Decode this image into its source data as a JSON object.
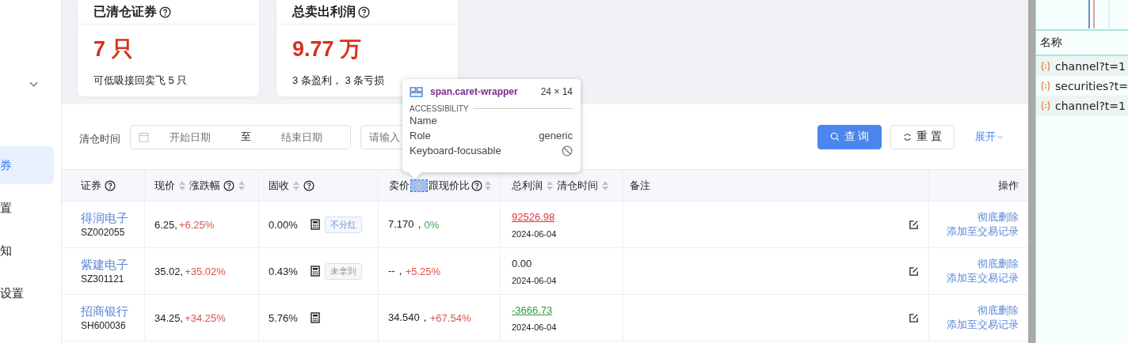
{
  "sidebar": {
    "items": [
      {
        "label": "券",
        "selected": true
      },
      {
        "label": "置",
        "selected": false
      },
      {
        "label": "知",
        "selected": false
      },
      {
        "label": "设置",
        "selected": false
      }
    ]
  },
  "cards": [
    {
      "title": "已清仓证券",
      "value": "7 只",
      "note": "可低吸接回卖飞 5 只"
    },
    {
      "title": "总卖出利润",
      "value": "9.77 万",
      "note": "3 条盈利， 3 条亏损"
    }
  ],
  "search": {
    "label": "清仓时间",
    "start_placeholder": "开始日期",
    "separator": "至",
    "end_placeholder": "结束日期",
    "keyword_placeholder": "请输入",
    "query_button": "查 询",
    "reset_button": "重 置",
    "expand_link": "展开"
  },
  "table": {
    "columns": [
      {
        "parts": [
          {
            "label": "证券",
            "sortable": false,
            "help": true
          }
        ]
      },
      {
        "parts": [
          {
            "label": "现价",
            "sortable": true,
            "help": false
          },
          {
            "label": "涨跌幅",
            "sortable": true,
            "help": true
          }
        ]
      },
      {
        "parts": [
          {
            "label": "固收",
            "sortable": true,
            "help": true,
            "kind": "sort-first"
          }
        ]
      },
      {
        "parts": [
          {
            "label": "卖价",
            "sortable": true,
            "help": false,
            "inspected": true
          },
          {
            "label": "跟现价比",
            "sortable": true,
            "help": true
          }
        ]
      },
      {
        "parts": [
          {
            "label": "总利润",
            "sortable": true,
            "help": false
          },
          {
            "label": "清仓时间",
            "sortable": true,
            "help": false
          }
        ]
      },
      {
        "parts": [
          {
            "label": "备注",
            "sortable": false,
            "help": false
          }
        ]
      },
      {
        "parts": [
          {
            "label": "操作",
            "sortable": false,
            "help": false
          }
        ]
      }
    ],
    "rows": [
      {
        "name": "得润电子",
        "code": "SZ002055",
        "price": "6.25,",
        "change": {
          "text": "+6.25%",
          "color": "#e0504a"
        },
        "yield": "0.00%",
        "tag": {
          "text": "不分红",
          "color": "#6e94d8"
        },
        "sell": "7.170，",
        "vs_price": {
          "text": "0%",
          "color": "#3ea550"
        },
        "profit": {
          "text": "92526.98",
          "color": "#e0303a",
          "underlined": true
        },
        "date": "2024-06-04",
        "actions": [
          "彻底删除",
          "添加至交易记录"
        ]
      },
      {
        "name": "紫建电子",
        "code": "SZ301121",
        "price": "35.02,",
        "change": {
          "text": "+35.02%",
          "color": "#e0504a"
        },
        "yield": "0.43%",
        "tag": {
          "text": "未拿到",
          "color": "#999999"
        },
        "sell": "--，",
        "vs_price": {
          "text": "+5.25%",
          "color": "#e0504a"
        },
        "profit": {
          "text": "0.00",
          "color": "#222222",
          "underlined": false
        },
        "date": "2024-06-04",
        "actions": [
          "彻底删除",
          "添加至交易记录"
        ]
      },
      {
        "name": "招商银行",
        "code": "SH600036",
        "price": "34.25,",
        "change": {
          "text": "+34.25%",
          "color": "#e0504a"
        },
        "yield": "5.76%",
        "sell": "34.540，",
        "vs_price": {
          "text": "+67.54%",
          "color": "#e0504a"
        },
        "profit": {
          "text": "-3666.73",
          "color": "#2e9a3e",
          "underlined": true
        },
        "date": "2024-06-04",
        "actions": [
          "彻底删除",
          "添加至交易记录"
        ]
      }
    ]
  },
  "inspector": {
    "selector": "span.caret-wrapper",
    "size": "24 × 14",
    "section": "ACCESSIBILITY",
    "rows": [
      {
        "label": "Name"
      },
      {
        "label": "Role",
        "value": "generic"
      },
      {
        "label": "Keyboard-focusable",
        "kind": "blocked"
      }
    ]
  },
  "network": {
    "header": "名称",
    "requests": [
      "channel?t=1",
      "securities?t=",
      "channel?t=1"
    ]
  }
}
